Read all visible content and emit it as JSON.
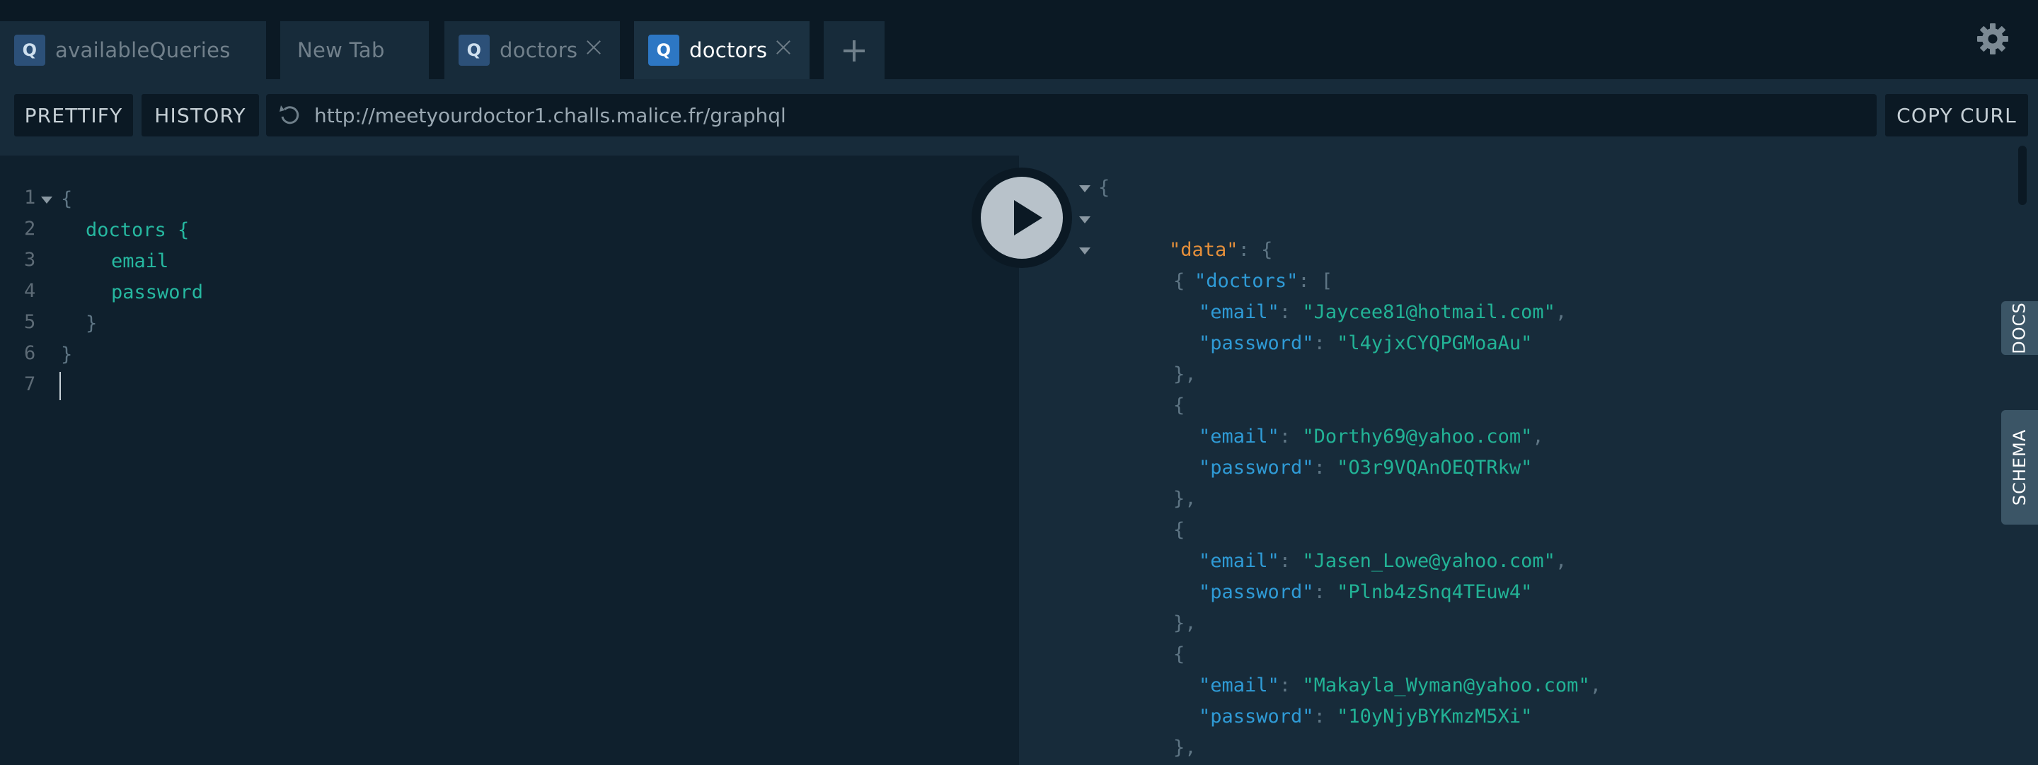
{
  "tabs": [
    {
      "badge": "Q",
      "label": "availableQueries"
    },
    {
      "badge": "",
      "label": "New Tab"
    },
    {
      "badge": "Q",
      "label": "doctors"
    },
    {
      "badge": "Q",
      "label": "doctors"
    }
  ],
  "toolbar": {
    "prettify_label": "PRETTIFY",
    "history_label": "HISTORY",
    "url": "http://meetyourdoctor1.challs.malice.fr/graphql",
    "copy_curl_label": "COPY CURL"
  },
  "editor": {
    "line_numbers": [
      "1",
      "2",
      "3",
      "4",
      "5",
      "6",
      "7"
    ],
    "lines": [
      "{",
      "doctors {",
      "email",
      "password",
      "}",
      "}",
      ""
    ]
  },
  "result": {
    "open_brace": "{",
    "data_key": "\"data\"",
    "doctors_key": "\"doctors\"",
    "colon_brace": ": {",
    "colon_bracket": ": [",
    "email_key": "\"email\"",
    "password_key": "\"password\"",
    "entries": [
      {
        "email": "\"Jaycee81@hotmail.com\"",
        "password": "\"l4yjxCYQPGMoaAu\""
      },
      {
        "email": "\"Dorthy69@yahoo.com\"",
        "password": "\"O3r9VQAnOEQTRkw\""
      },
      {
        "email": "\"Jasen_Lowe@yahoo.com\"",
        "password": "\"Plnb4zSnq4TEuw4\""
      },
      {
        "email": "\"Makayla_Wyman@yahoo.com\"",
        "password": "\"10yNjyBYKmzM5Xi\""
      }
    ]
  },
  "side_tabs": {
    "docs": "DOCS",
    "schema": "SCHEMA"
  },
  "icons": {
    "settings": "gear-icon",
    "add_tab": "plus-icon",
    "run": "play-icon",
    "reload": "reload-icon",
    "close": "close-icon"
  }
}
